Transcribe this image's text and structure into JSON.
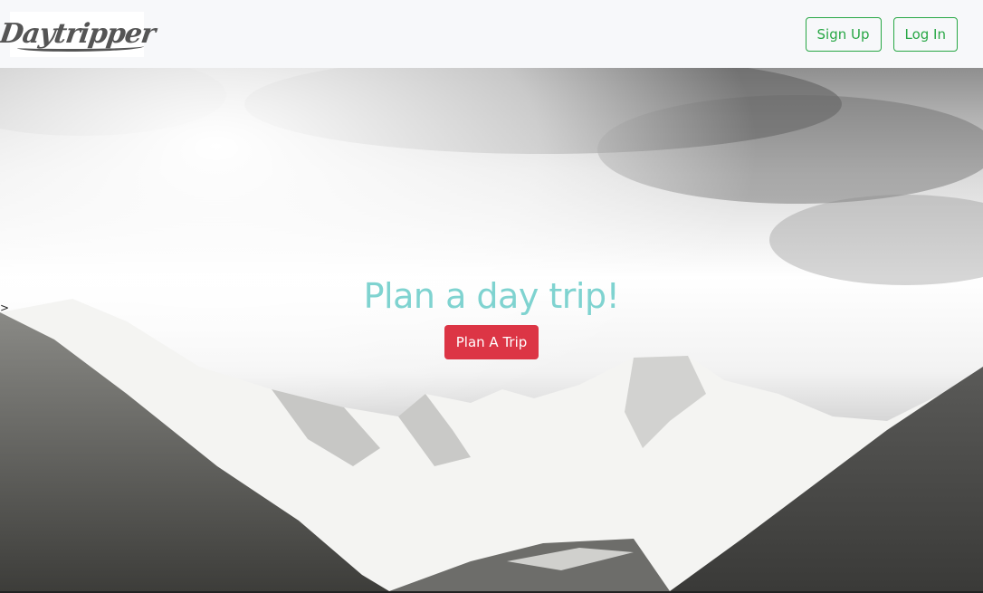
{
  "navbar": {
    "logo_text": "Daytripper",
    "signup_label": "Sign Up",
    "login_label": "Log In"
  },
  "hero": {
    "title": "Plan a day trip!",
    "cta_label": "Plan A Trip",
    "edge_glyph": ">"
  },
  "colors": {
    "title": "#7fd3d0",
    "cta": "#dc3545",
    "outline": "#28a745",
    "navbar_bg": "#f7f8fa"
  }
}
